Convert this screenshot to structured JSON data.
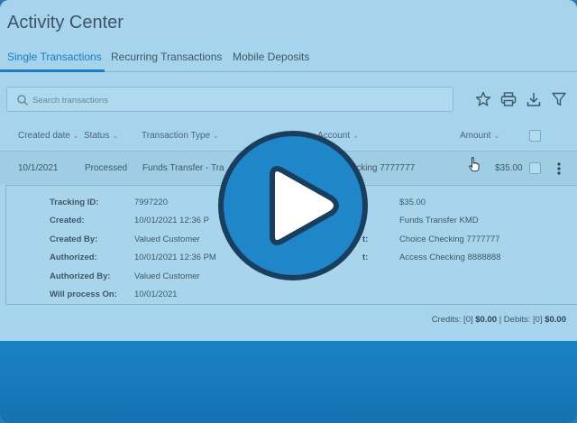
{
  "page": {
    "title": "Activity Center"
  },
  "tabs": [
    {
      "label": "Single Transactions",
      "active": true
    },
    {
      "label": "Recurring Transactions",
      "active": false
    },
    {
      "label": "Mobile Deposits",
      "active": false
    }
  ],
  "search": {
    "placeholder": "Search transactions",
    "value": ""
  },
  "toolbar": {
    "icons": [
      "star-icon",
      "print-icon",
      "download-icon",
      "filter-icon"
    ]
  },
  "columns": [
    {
      "label": "Created date"
    },
    {
      "label": "Status"
    },
    {
      "label": "Transaction Type"
    },
    {
      "label": "Account"
    },
    {
      "label": "Amount"
    }
  ],
  "row": {
    "date": "10/1/2021",
    "status": "Processed",
    "type": "Funds Transfer - Tra",
    "account": "hecking 7777777",
    "amount": "$35.00"
  },
  "details": {
    "left": [
      {
        "label": "Tracking ID:",
        "value": "7997220"
      },
      {
        "label": "Created:",
        "value": "10/01/2021 12:36 P"
      },
      {
        "label": "Created By:",
        "value": "Valued Customer"
      },
      {
        "label": "Authorized:",
        "value": "10/01/2021 12:36 PM"
      },
      {
        "label": "Authorized By:",
        "value": "Valued Customer"
      },
      {
        "label": "Will process On:",
        "value": "10/01/2021"
      }
    ],
    "right": [
      {
        "label": "",
        "value": "$35.00"
      },
      {
        "label": "",
        "value": "Funds Transfer KMD"
      },
      {
        "label": "t:",
        "value": "Choice Checking 7777777"
      },
      {
        "label": "t:",
        "value": "Access Checking 8888888"
      }
    ]
  },
  "totals": {
    "credits_label": "Credits: [0]",
    "credits_value": "$0.00",
    "separator": "|",
    "debits_label": "Debits: [0]",
    "debits_value": "$0.00"
  },
  "colors": {
    "accent": "#1c7ec0",
    "play_button": "#1f86c9",
    "play_border": "#1a3f5e"
  }
}
